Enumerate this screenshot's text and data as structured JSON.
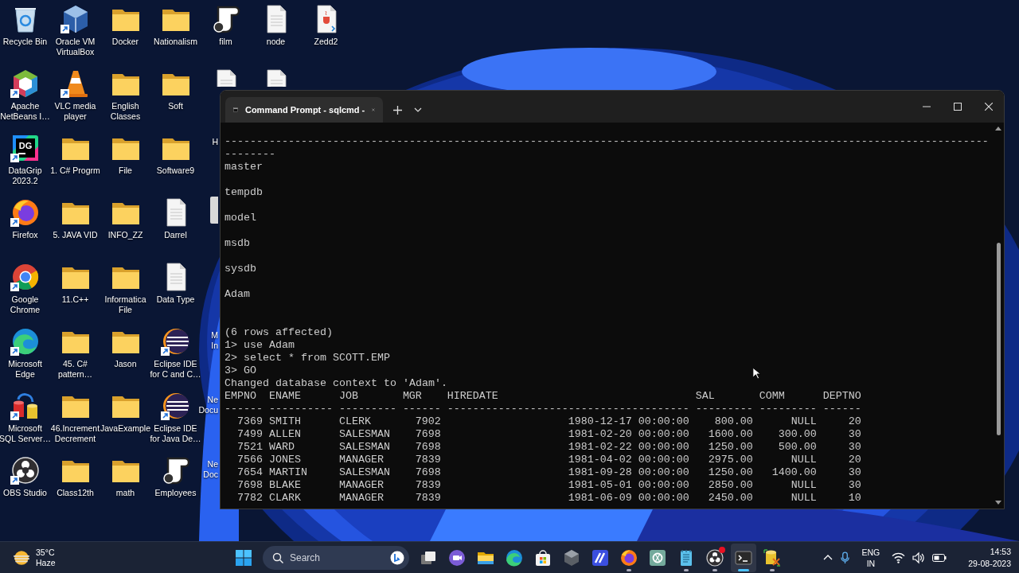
{
  "desktop": {
    "columns": [
      {
        "items": [
          {
            "kind": "recycle",
            "lines": [
              "Recycle Bin"
            ],
            "shortcut": false
          },
          {
            "kind": "netbeans",
            "lines": [
              "Apache",
              "NetBeans I…"
            ],
            "shortcut": true
          },
          {
            "kind": "dg",
            "logo_text": "DG",
            "lines": [
              "DataGrip",
              "2023.2"
            ],
            "shortcut": true
          },
          {
            "kind": "firefox",
            "lines": [
              "Firefox"
            ],
            "shortcut": true
          },
          {
            "kind": "chrome",
            "lines": [
              "Google",
              "Chrome"
            ],
            "shortcut": true
          },
          {
            "kind": "edge",
            "lines": [
              "Microsoft",
              "Edge"
            ],
            "shortcut": true
          },
          {
            "kind": "sqlserver",
            "lines": [
              "Microsoft",
              "SQL Server…"
            ],
            "shortcut": true
          },
          {
            "kind": "obs",
            "lines": [
              "OBS Studio"
            ],
            "shortcut": true
          }
        ]
      },
      {
        "items": [
          {
            "kind": "cube",
            "lines": [
              "Oracle VM",
              "VirtualBox"
            ],
            "shortcut": true
          },
          {
            "kind": "cone",
            "lines": [
              "VLC media",
              "player"
            ],
            "shortcut": true
          },
          {
            "kind": "folder",
            "lines": [
              "1. C# Progrm"
            ],
            "shortcut": false
          },
          {
            "kind": "folder",
            "lines": [
              "5. JAVA VID"
            ],
            "shortcut": false
          },
          {
            "kind": "folder",
            "lines": [
              "11.C++"
            ],
            "shortcut": false
          },
          {
            "kind": "folder",
            "lines": [
              "45. C#",
              "pattern…"
            ],
            "shortcut": false
          },
          {
            "kind": "folder",
            "lines": [
              "46.Increment",
              "Decrement"
            ],
            "shortcut": false
          },
          {
            "kind": "folder",
            "lines": [
              "Class12th"
            ],
            "shortcut": false
          }
        ]
      },
      {
        "items": [
          {
            "kind": "folder",
            "lines": [
              "Docker"
            ],
            "shortcut": false
          },
          {
            "kind": "folder",
            "lines": [
              "English",
              "Classes"
            ],
            "shortcut": false
          },
          {
            "kind": "folder",
            "lines": [
              "File"
            ],
            "shortcut": false
          },
          {
            "kind": "folder",
            "lines": [
              "INFO_ZZ"
            ],
            "shortcut": false
          },
          {
            "kind": "folder",
            "lines": [
              "Informatica",
              "File"
            ],
            "shortcut": false
          },
          {
            "kind": "folder",
            "lines": [
              "Jason"
            ],
            "shortcut": false
          },
          {
            "kind": "folder",
            "lines": [
              "JavaExample"
            ],
            "shortcut": false
          },
          {
            "kind": "folder",
            "lines": [
              "math"
            ],
            "shortcut": false
          }
        ]
      },
      {
        "items": [
          {
            "kind": "folder",
            "lines": [
              "Nationalism"
            ],
            "shortcut": false
          },
          {
            "kind": "folder",
            "lines": [
              "Soft"
            ],
            "shortcut": false
          },
          {
            "kind": "folder",
            "lines": [
              "Software9"
            ],
            "shortcut": false
          },
          {
            "kind": "document",
            "lines": [
              "Darrel"
            ],
            "shortcut": false
          },
          {
            "kind": "document",
            "lines": [
              "Data Type"
            ],
            "shortcut": false
          },
          {
            "kind": "eclipse",
            "lines": [
              "Eclipse IDE",
              "for C and C…"
            ],
            "shortcut": true
          },
          {
            "kind": "eclipse",
            "lines": [
              "Eclipse IDE",
              "for Java De…"
            ],
            "shortcut": true
          },
          {
            "kind": "scroll",
            "lines": [
              "Employees"
            ],
            "shortcut": false
          }
        ]
      },
      {
        "items": [
          {
            "kind": "scroll",
            "lines": [
              "film"
            ],
            "shortcut": false
          },
          {
            "kind": "document"
          },
          {
            "kind": "partial",
            "lines": [
              "H"
            ]
          },
          {
            "kind": "partial"
          },
          {
            "kind": "empty"
          },
          {
            "kind": "partial",
            "lines": [
              "M",
              "In"
            ]
          },
          {
            "kind": "partial",
            "lines": [
              "Ne",
              "Docu"
            ]
          },
          {
            "kind": "partial",
            "lines": [
              "Ne",
              "Doc"
            ]
          }
        ]
      },
      {
        "items": [
          {
            "kind": "document",
            "lines": [
              "node"
            ],
            "shortcut": false
          },
          {
            "kind": "document"
          }
        ]
      },
      {
        "items": [
          {
            "kind": "java",
            "lines": [
              "Zedd2"
            ],
            "shortcut": false
          }
        ]
      }
    ]
  },
  "terminal": {
    "tab_title": "Command Prompt - sqlcmd -",
    "lines": [
      {
        "kind": "text",
        "text": "--------------------------------------------------------------------------------------------------------------------------------"
      },
      {
        "kind": "db",
        "text": "master"
      },
      {
        "kind": "db",
        "text": "tempdb"
      },
      {
        "kind": "db",
        "text": "model"
      },
      {
        "kind": "db",
        "text": "msdb"
      },
      {
        "kind": "db",
        "text": "sysdb"
      },
      {
        "kind": "db",
        "text": "Adam"
      },
      {
        "kind": "blank"
      },
      {
        "kind": "text",
        "text": "(6 rows affected)"
      },
      {
        "kind": "text",
        "text": "1> use Adam"
      },
      {
        "kind": "text",
        "text": "2> select * from SCOTT.EMP"
      },
      {
        "kind": "text",
        "text": "3> GO"
      },
      {
        "kind": "text",
        "text": "Changed database context to 'Adam'."
      }
    ],
    "result": {
      "columns": [
        "EMPNO",
        "ENAME",
        "JOB",
        "MGR",
        "HIREDATE",
        "SAL",
        "COMM",
        "DEPTNO"
      ],
      "rule": [
        "------",
        "----------",
        "---------",
        "------",
        "--------------------------------------",
        "---------",
        "---------",
        "------"
      ],
      "rows": [
        [
          "7369",
          "SMITH",
          "CLERK",
          "7902",
          "1980-12-17 00:00:00",
          "800.00",
          "NULL",
          "20"
        ],
        [
          "7499",
          "ALLEN",
          "SALESMAN",
          "7698",
          "1981-02-20 00:00:00",
          "1600.00",
          "300.00",
          "30"
        ],
        [
          "7521",
          "WARD",
          "SALESMAN",
          "7698",
          "1981-02-22 00:00:00",
          "1250.00",
          "500.00",
          "30"
        ],
        [
          "7566",
          "JONES",
          "MANAGER",
          "7839",
          "1981-04-02 00:00:00",
          "2975.00",
          "NULL",
          "20"
        ],
        [
          "7654",
          "MARTIN",
          "SALESMAN",
          "7698",
          "1981-09-28 00:00:00",
          "1250.00",
          "1400.00",
          "30"
        ],
        [
          "7698",
          "BLAKE",
          "MANAGER",
          "7839",
          "1981-05-01 00:00:00",
          "2850.00",
          "NULL",
          "30"
        ],
        [
          "7782",
          "CLARK",
          "MANAGER",
          "7839",
          "1981-06-09 00:00:00",
          "2450.00",
          "NULL",
          "10"
        ]
      ]
    }
  },
  "taskbar": {
    "weather": {
      "temperature": "35°C",
      "condition": "Haze"
    },
    "search": {
      "placeholder": "Search"
    },
    "apps": [
      {
        "kind": "start",
        "running": false,
        "active": false,
        "alert": false
      },
      {
        "kind": "search"
      },
      {
        "kind": "taskview",
        "running": false,
        "active": false,
        "alert": false
      },
      {
        "kind": "chat",
        "running": false,
        "active": false,
        "alert": false
      },
      {
        "kind": "explorer",
        "running": false,
        "active": false,
        "alert": false
      },
      {
        "kind": "edge",
        "running": false,
        "active": false,
        "alert": false
      },
      {
        "kind": "store",
        "running": false,
        "active": false,
        "alert": false
      },
      {
        "kind": "hexagon",
        "running": false,
        "active": false,
        "alert": false
      },
      {
        "kind": "slashes",
        "running": false,
        "active": false,
        "alert": false
      },
      {
        "kind": "firefox",
        "running": true,
        "active": false,
        "alert": false
      },
      {
        "kind": "knot",
        "running": false,
        "active": false,
        "alert": false
      },
      {
        "kind": "notepad",
        "running": true,
        "active": false,
        "alert": false
      },
      {
        "kind": "obs",
        "running": true,
        "active": false,
        "alert": true
      },
      {
        "kind": "terminal",
        "running": true,
        "active": true,
        "alert": false
      },
      {
        "kind": "database",
        "running": true,
        "active": false,
        "alert": false
      }
    ],
    "language": [
      "ENG",
      "IN"
    ],
    "time": "14:53",
    "date": "29-08-2023"
  }
}
